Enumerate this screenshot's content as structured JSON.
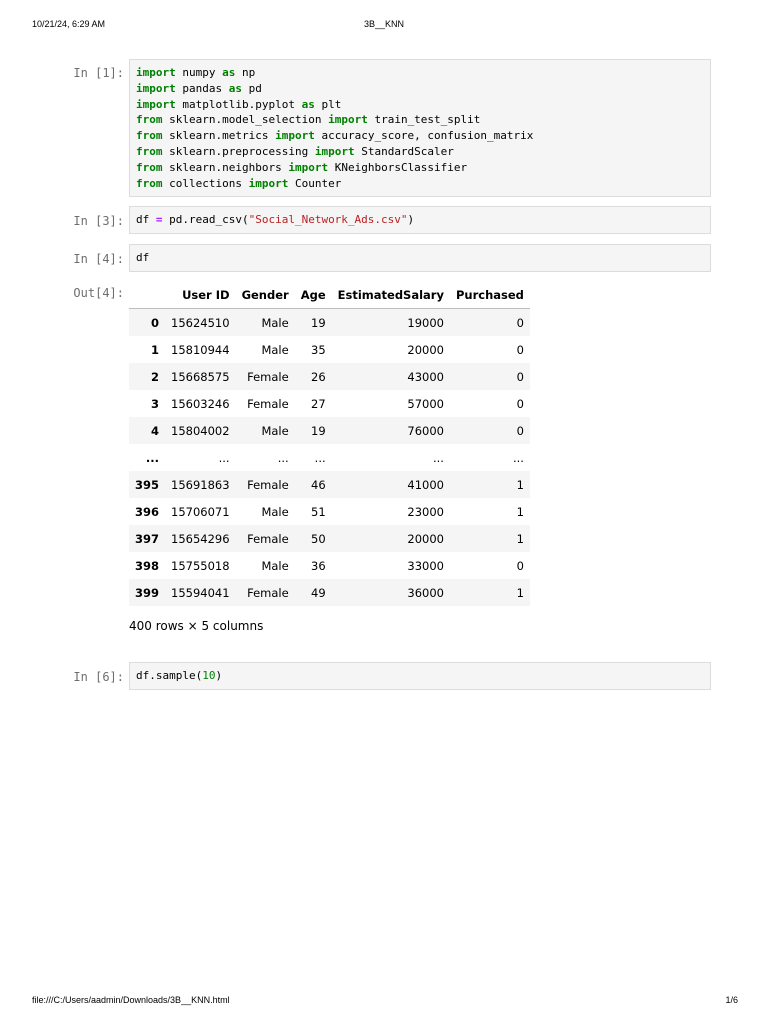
{
  "print_header": {
    "datetime": "10/21/24, 6:29 AM",
    "title": "3B__KNN"
  },
  "print_footer": {
    "path": "file:///C:/Users/aadmin/Downloads/3B__KNN.html",
    "page": "1/6"
  },
  "cells": {
    "imports": {
      "prompt": "In [1]:"
    },
    "read_csv": {
      "prompt": "In [3]:"
    },
    "show_df": {
      "prompt": "In [4]:",
      "code": "df",
      "out_prompt": "Out[4]:"
    },
    "sample": {
      "prompt": "In [6]:"
    }
  },
  "code_tokens": {
    "import": "import",
    "from": "from",
    "as": "as",
    "numpy": " numpy ",
    "np": " np",
    "pandas": " pandas ",
    "pd": " pd",
    "matplotlib": " matplotlib.pyplot ",
    "plt": " plt",
    "model_selection": " sklearn.model_selection ",
    "train_test_split": " train_test_split",
    "metrics": " sklearn.metrics ",
    "metrics_names": " accuracy_score, confusion_matrix",
    "preprocessing": " sklearn.preprocessing ",
    "StandardScaler": " StandardScaler",
    "neighbors": " sklearn.neighbors ",
    "KNeighborsClassifier": " KNeighborsClassifier",
    "collections": " collections ",
    "Counter": " Counter",
    "df": "df ",
    "eq": "=",
    "read_csv": " pd.read_csv(",
    "csv_name": "\"Social_Network_Ads.csv\"",
    "close_paren": ")",
    "sample_call": "df.sample(",
    "sample_n": "10",
    "sample_close": ")"
  },
  "dataframe": {
    "columns": [
      "",
      "User ID",
      "Gender",
      "Age",
      "EstimatedSalary",
      "Purchased"
    ],
    "rows": [
      [
        "0",
        "15624510",
        "Male",
        "19",
        "19000",
        "0"
      ],
      [
        "1",
        "15810944",
        "Male",
        "35",
        "20000",
        "0"
      ],
      [
        "2",
        "15668575",
        "Female",
        "26",
        "43000",
        "0"
      ],
      [
        "3",
        "15603246",
        "Female",
        "27",
        "57000",
        "0"
      ],
      [
        "4",
        "15804002",
        "Male",
        "19",
        "76000",
        "0"
      ],
      [
        "...",
        "...",
        "...",
        "...",
        "...",
        "..."
      ],
      [
        "395",
        "15691863",
        "Female",
        "46",
        "41000",
        "1"
      ],
      [
        "396",
        "15706071",
        "Male",
        "51",
        "23000",
        "1"
      ],
      [
        "397",
        "15654296",
        "Female",
        "50",
        "20000",
        "1"
      ],
      [
        "398",
        "15755018",
        "Male",
        "36",
        "33000",
        "0"
      ],
      [
        "399",
        "15594041",
        "Female",
        "49",
        "36000",
        "1"
      ]
    ],
    "shape_text": "400 rows × 5 columns"
  },
  "colors": {
    "keyword": "#008000",
    "string": "#ba2121",
    "operator": "#aa22ff",
    "prompt": "#6e6e6e",
    "code_bg": "#f5f5f5"
  }
}
